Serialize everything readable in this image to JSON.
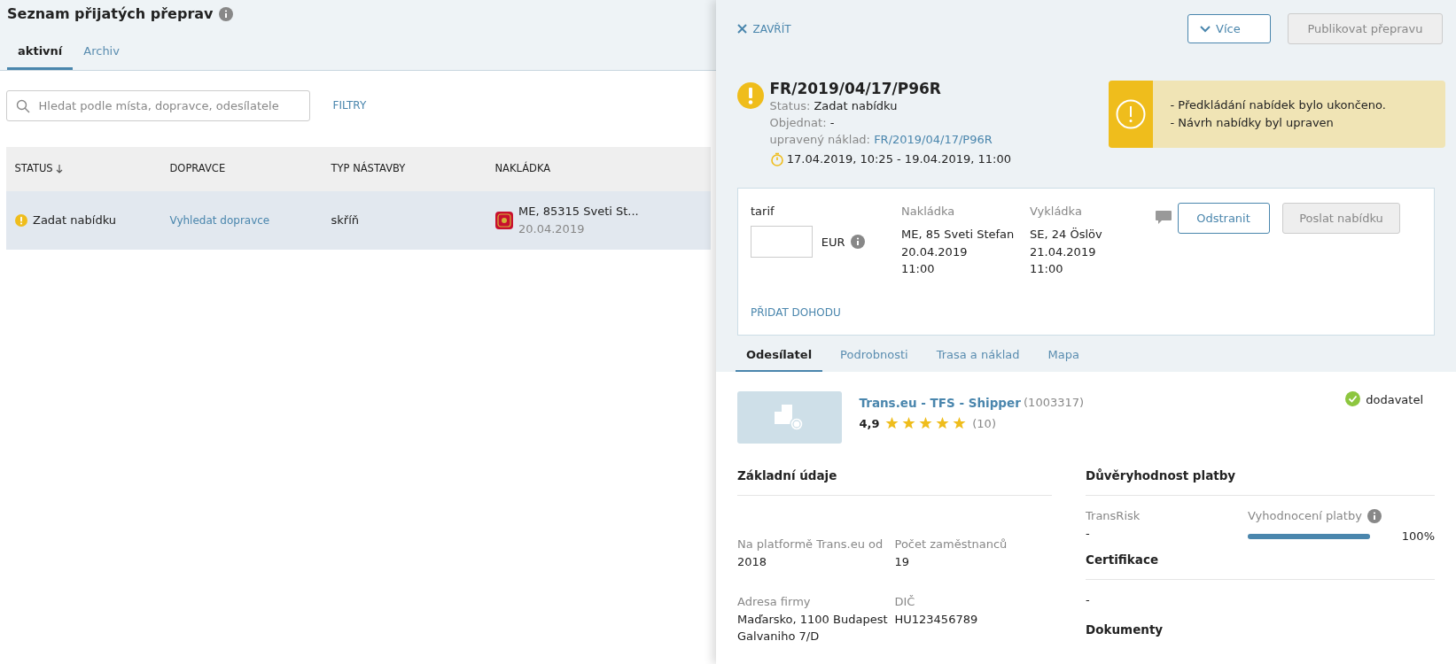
{
  "page": {
    "title": "Seznam přijatých přeprav",
    "tabs": [
      {
        "label": "aktivní",
        "selected": true
      },
      {
        "label": "Archiv",
        "selected": false
      }
    ],
    "search": {
      "placeholder": "Hledat podle místa, dopravce, odesílatele"
    },
    "filter_button": "FILTRY",
    "table": {
      "columns": [
        {
          "label": "STATUS",
          "sorted": true
        },
        {
          "label": "DOPRAVCE",
          "sorted": false
        },
        {
          "label": "TYP NÁSTAVBY",
          "sorted": false
        },
        {
          "label": "NAKLÁDKA",
          "sorted": false
        }
      ],
      "rows": [
        {
          "selected": true,
          "status": "Zadat nabídku",
          "carrier": "Vyhledat dopravce",
          "body_type": "skříň",
          "loading_place": "ME, 85315 Sveti St...",
          "loading_date": "20.04.2019"
        }
      ]
    }
  },
  "drawer": {
    "close": "ZAVŘÍT",
    "more_button": "Více",
    "publish_button": {
      "label": "Publikovat přepravu",
      "disabled": true
    },
    "order": {
      "number": "FR/2019/04/17/P96R",
      "status_label": "Status:",
      "status": "Zadat nabídku",
      "order_label": "Objednat:",
      "order_value": "-",
      "cargo_label": "upravený náklad:",
      "cargo_link": "FR/2019/04/17/P96R",
      "time_range": "17.04.2019, 10:25 - 19.04.2019, 11:00"
    },
    "alert": {
      "lines": [
        "- Předkládání nabídek bylo ukončeno.",
        "- Návrh nabídky byl upraven"
      ]
    },
    "offer": {
      "tariff_label": "tarif",
      "currency": "EUR",
      "loading": {
        "label": "Nakládka",
        "lines": [
          "ME, 85 Sveti Stefan",
          "20.04.2019",
          "11:00"
        ]
      },
      "unloading": {
        "label": "Vykládka",
        "lines": [
          "SE, 24 Öslöv",
          "21.04.2019",
          "11:00"
        ]
      },
      "remove_button": {
        "label": "Odstranit",
        "disabled": false
      },
      "send_button": {
        "label": "Poslat nabídku",
        "disabled": true
      },
      "add_agreement": "PŘIDAT DOHODU"
    },
    "tabs": [
      {
        "label": "Odesílatel",
        "selected": true
      },
      {
        "label": "Podrobnosti",
        "selected": false
      },
      {
        "label": "Trasa a náklad",
        "selected": false
      },
      {
        "label": "Mapa",
        "selected": false
      }
    ],
    "shipper": {
      "name": "Trans.eu - TFS - Shipper",
      "id": "(1003317)",
      "rating": "4,9",
      "stars": 5,
      "reviews": "(10)",
      "badge": "dodavatel"
    },
    "basic": {
      "title": "Základní údaje",
      "fields": [
        {
          "label": "Na platformě Trans.eu od",
          "lines": [
            "2018"
          ]
        },
        {
          "label": "Počet zaměstnanců",
          "lines": [
            "19"
          ]
        },
        {
          "label": "Adresa firmy",
          "lines": [
            "Maďarsko, 1100 Budapest",
            "Galvaniho 7/D"
          ]
        },
        {
          "label": "DIČ",
          "lines": [
            "HU123456789"
          ]
        }
      ]
    },
    "payment": {
      "title": "Důvěryhodnost platby",
      "transrisk": {
        "label": "TransRisk",
        "value": "-"
      },
      "evaluation": {
        "label": "Vyhodnocení platby",
        "level": 1,
        "reading": "100%"
      }
    },
    "certification": {
      "title": "Certifikace",
      "value": "-"
    },
    "documents": {
      "title": "Dokumenty"
    }
  }
}
